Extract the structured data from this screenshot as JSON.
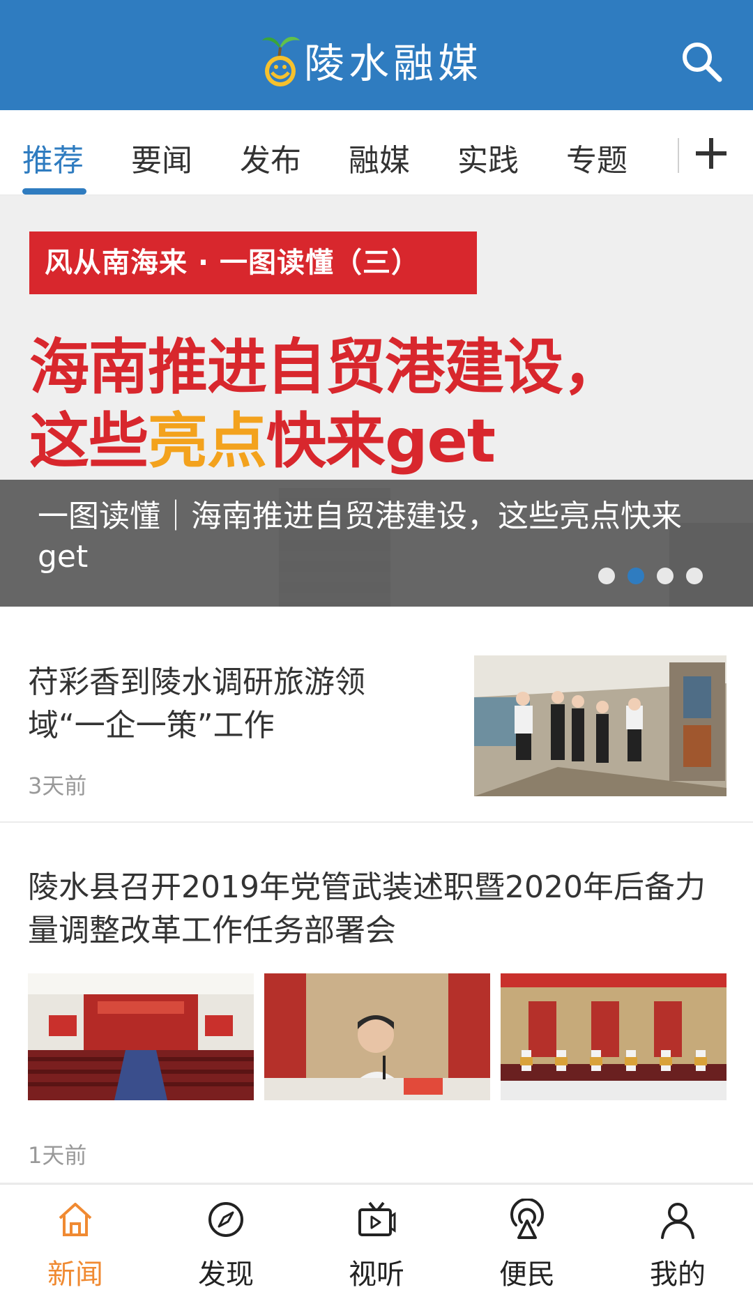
{
  "header": {
    "app_name": "陵水融媒",
    "search_icon": "search-icon",
    "colors": {
      "bar": "#2f7cc0",
      "text": "#ffffff"
    }
  },
  "tabs": {
    "items": [
      {
        "label": "推荐",
        "active": true
      },
      {
        "label": "要闻",
        "active": false
      },
      {
        "label": "发布",
        "active": false
      },
      {
        "label": "融媒",
        "active": false
      },
      {
        "label": "实践",
        "active": false
      },
      {
        "label": "专题",
        "active": false
      }
    ],
    "add_icon": "plus-icon",
    "active_color": "#2f7cc0"
  },
  "banner": {
    "tag": "风从南海来 · 一图读懂（三）",
    "headline_line1": "海南推进自贸港建设，",
    "headline_line2_a": "这些",
    "headline_line2_b": "亮点",
    "headline_line2_c": "快来get",
    "caption": "一图读懂｜海南推进自贸港建设，这些亮点快来get",
    "dots": {
      "count": 4,
      "active_index": 1
    },
    "colors": {
      "red": "#d8272d",
      "orange": "#f3a21d"
    }
  },
  "articles": [
    {
      "title": "苻彩香到陵水调研旅游领域“一企一策”工作",
      "time": "3天前"
    },
    {
      "title": "陵水县召开2019年党管武装述职暨2020年后备力量调整改革工作任务部署会",
      "time": "1天前"
    }
  ],
  "bottom_nav": {
    "items": [
      {
        "label": "新闻",
        "icon": "home-icon",
        "active": true
      },
      {
        "label": "发现",
        "icon": "compass-icon",
        "active": false
      },
      {
        "label": "视听",
        "icon": "tv-play-icon",
        "active": false
      },
      {
        "label": "便民",
        "icon": "location-pin-icon",
        "active": false
      },
      {
        "label": "我的",
        "icon": "user-icon",
        "active": false
      }
    ],
    "active_color": "#f08a32"
  }
}
